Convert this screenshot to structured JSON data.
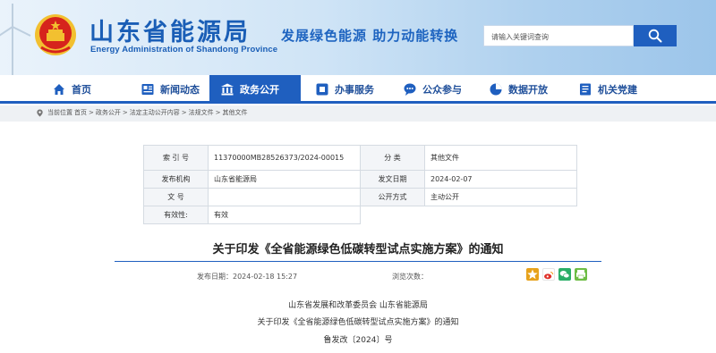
{
  "header": {
    "title": "山东省能源局",
    "title_en": "Energy Administration of Shandong Province",
    "slogan": "发展绿色能源  助力动能转换"
  },
  "search": {
    "placeholder": "请输入关键词查询",
    "icon": "search-icon"
  },
  "nav": {
    "items": [
      {
        "label": "首页",
        "icon": "home-icon"
      },
      {
        "label": "新闻动态",
        "icon": "news-icon"
      },
      {
        "label": "政务公开",
        "icon": "government-icon",
        "active": true
      },
      {
        "label": "办事服务",
        "icon": "service-icon"
      },
      {
        "label": "公众参与",
        "icon": "chat-icon"
      },
      {
        "label": "数据开放",
        "icon": "pie-chart-icon"
      },
      {
        "label": "机关党建",
        "icon": "document-icon"
      }
    ]
  },
  "breadcrumb": {
    "items": [
      "当前位置",
      "首页",
      "政务公开",
      "法定主动公开内容",
      "法规文件",
      "其他文件"
    ],
    "separator": ">"
  },
  "info_table": {
    "rows": [
      {
        "k1": "索  引  号",
        "v1": "11370000MB28526373/2024-00015",
        "k2": "分      类",
        "v2": "其他文件"
      },
      {
        "k1": "发布机构",
        "v1": "山东省能源局",
        "k2": "发文日期",
        "v2": "2024-02-07"
      },
      {
        "k1": "文      号",
        "v1": "",
        "k2": "公开方式",
        "v2": "主动公开"
      },
      {
        "k1": "有效性:",
        "v1": "有效"
      }
    ]
  },
  "article": {
    "title": "关于印发《全省能源绿色低碳转型试点实施方案》的通知",
    "date_label": "发布日期：",
    "date": "2024-02-18 15:27",
    "views_label": "浏览次数：",
    "body": [
      "山东省发展和改革委员会  山东省能源局",
      "关于印发《全省能源绿色低碳转型试点实施方案》的通知",
      "鲁发改〔2024〕号"
    ]
  },
  "colors": {
    "primary": "#1f5fbf",
    "title_blue": "#1a5eb6",
    "emblem_red": "#d6231c",
    "emblem_gold": "#f2c030"
  }
}
